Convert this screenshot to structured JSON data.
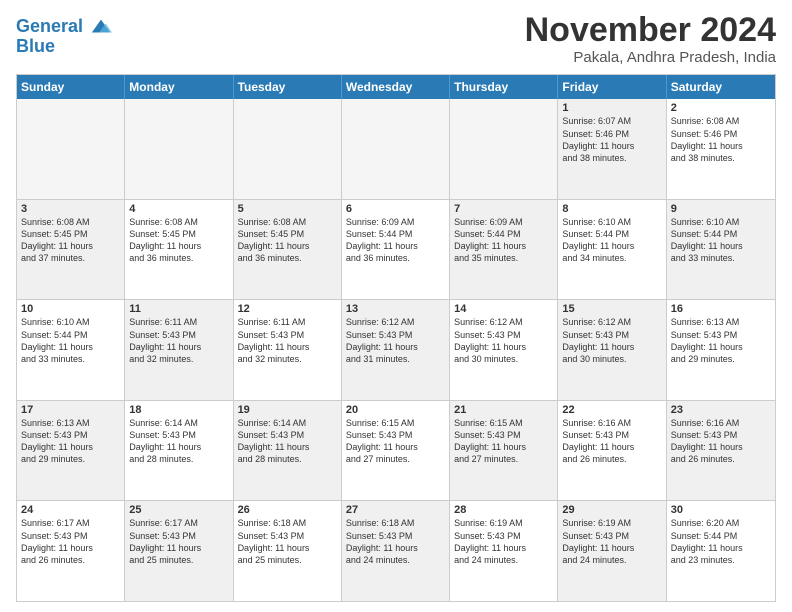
{
  "header": {
    "logo_line1": "General",
    "logo_line2": "Blue",
    "month": "November 2024",
    "location": "Pakala, Andhra Pradesh, India"
  },
  "weekdays": [
    "Sunday",
    "Monday",
    "Tuesday",
    "Wednesday",
    "Thursday",
    "Friday",
    "Saturday"
  ],
  "rows": [
    [
      {
        "day": "",
        "info": "",
        "empty": true
      },
      {
        "day": "",
        "info": "",
        "empty": true
      },
      {
        "day": "",
        "info": "",
        "empty": true
      },
      {
        "day": "",
        "info": "",
        "empty": true
      },
      {
        "day": "",
        "info": "",
        "empty": true
      },
      {
        "day": "1",
        "info": "Sunrise: 6:07 AM\nSunset: 5:46 PM\nDaylight: 11 hours\nand 38 minutes.",
        "shaded": true
      },
      {
        "day": "2",
        "info": "Sunrise: 6:08 AM\nSunset: 5:46 PM\nDaylight: 11 hours\nand 38 minutes.",
        "shaded": false
      }
    ],
    [
      {
        "day": "3",
        "info": "Sunrise: 6:08 AM\nSunset: 5:45 PM\nDaylight: 11 hours\nand 37 minutes.",
        "shaded": true
      },
      {
        "day": "4",
        "info": "Sunrise: 6:08 AM\nSunset: 5:45 PM\nDaylight: 11 hours\nand 36 minutes.",
        "shaded": false
      },
      {
        "day": "5",
        "info": "Sunrise: 6:08 AM\nSunset: 5:45 PM\nDaylight: 11 hours\nand 36 minutes.",
        "shaded": true
      },
      {
        "day": "6",
        "info": "Sunrise: 6:09 AM\nSunset: 5:44 PM\nDaylight: 11 hours\nand 36 minutes.",
        "shaded": false
      },
      {
        "day": "7",
        "info": "Sunrise: 6:09 AM\nSunset: 5:44 PM\nDaylight: 11 hours\nand 35 minutes.",
        "shaded": true
      },
      {
        "day": "8",
        "info": "Sunrise: 6:10 AM\nSunset: 5:44 PM\nDaylight: 11 hours\nand 34 minutes.",
        "shaded": false
      },
      {
        "day": "9",
        "info": "Sunrise: 6:10 AM\nSunset: 5:44 PM\nDaylight: 11 hours\nand 33 minutes.",
        "shaded": true
      }
    ],
    [
      {
        "day": "10",
        "info": "Sunrise: 6:10 AM\nSunset: 5:44 PM\nDaylight: 11 hours\nand 33 minutes.",
        "shaded": false
      },
      {
        "day": "11",
        "info": "Sunrise: 6:11 AM\nSunset: 5:43 PM\nDaylight: 11 hours\nand 32 minutes.",
        "shaded": true
      },
      {
        "day": "12",
        "info": "Sunrise: 6:11 AM\nSunset: 5:43 PM\nDaylight: 11 hours\nand 32 minutes.",
        "shaded": false
      },
      {
        "day": "13",
        "info": "Sunrise: 6:12 AM\nSunset: 5:43 PM\nDaylight: 11 hours\nand 31 minutes.",
        "shaded": true
      },
      {
        "day": "14",
        "info": "Sunrise: 6:12 AM\nSunset: 5:43 PM\nDaylight: 11 hours\nand 30 minutes.",
        "shaded": false
      },
      {
        "day": "15",
        "info": "Sunrise: 6:12 AM\nSunset: 5:43 PM\nDaylight: 11 hours\nand 30 minutes.",
        "shaded": true
      },
      {
        "day": "16",
        "info": "Sunrise: 6:13 AM\nSunset: 5:43 PM\nDaylight: 11 hours\nand 29 minutes.",
        "shaded": false
      }
    ],
    [
      {
        "day": "17",
        "info": "Sunrise: 6:13 AM\nSunset: 5:43 PM\nDaylight: 11 hours\nand 29 minutes.",
        "shaded": true
      },
      {
        "day": "18",
        "info": "Sunrise: 6:14 AM\nSunset: 5:43 PM\nDaylight: 11 hours\nand 28 minutes.",
        "shaded": false
      },
      {
        "day": "19",
        "info": "Sunrise: 6:14 AM\nSunset: 5:43 PM\nDaylight: 11 hours\nand 28 minutes.",
        "shaded": true
      },
      {
        "day": "20",
        "info": "Sunrise: 6:15 AM\nSunset: 5:43 PM\nDaylight: 11 hours\nand 27 minutes.",
        "shaded": false
      },
      {
        "day": "21",
        "info": "Sunrise: 6:15 AM\nSunset: 5:43 PM\nDaylight: 11 hours\nand 27 minutes.",
        "shaded": true
      },
      {
        "day": "22",
        "info": "Sunrise: 6:16 AM\nSunset: 5:43 PM\nDaylight: 11 hours\nand 26 minutes.",
        "shaded": false
      },
      {
        "day": "23",
        "info": "Sunrise: 6:16 AM\nSunset: 5:43 PM\nDaylight: 11 hours\nand 26 minutes.",
        "shaded": true
      }
    ],
    [
      {
        "day": "24",
        "info": "Sunrise: 6:17 AM\nSunset: 5:43 PM\nDaylight: 11 hours\nand 26 minutes.",
        "shaded": false
      },
      {
        "day": "25",
        "info": "Sunrise: 6:17 AM\nSunset: 5:43 PM\nDaylight: 11 hours\nand 25 minutes.",
        "shaded": true
      },
      {
        "day": "26",
        "info": "Sunrise: 6:18 AM\nSunset: 5:43 PM\nDaylight: 11 hours\nand 25 minutes.",
        "shaded": false
      },
      {
        "day": "27",
        "info": "Sunrise: 6:18 AM\nSunset: 5:43 PM\nDaylight: 11 hours\nand 24 minutes.",
        "shaded": true
      },
      {
        "day": "28",
        "info": "Sunrise: 6:19 AM\nSunset: 5:43 PM\nDaylight: 11 hours\nand 24 minutes.",
        "shaded": false
      },
      {
        "day": "29",
        "info": "Sunrise: 6:19 AM\nSunset: 5:43 PM\nDaylight: 11 hours\nand 24 minutes.",
        "shaded": true
      },
      {
        "day": "30",
        "info": "Sunrise: 6:20 AM\nSunset: 5:44 PM\nDaylight: 11 hours\nand 23 minutes.",
        "shaded": false
      }
    ]
  ]
}
